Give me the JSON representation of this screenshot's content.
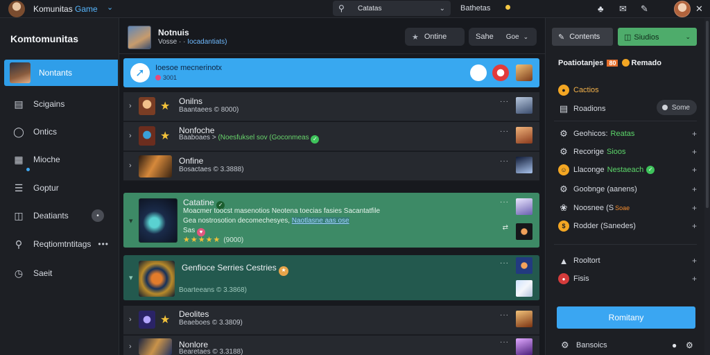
{
  "app": {
    "title_main": "Komunitas",
    "title_accent": "Game",
    "search_value": "Catatas",
    "top_tab": "Bathetas"
  },
  "sidebar": {
    "title": "Komtomunitas",
    "items": [
      {
        "label": "Nontants",
        "icon": "user-avatar"
      },
      {
        "label": "Scigains",
        "icon": "columns-icon"
      },
      {
        "label": "Ontics",
        "icon": "circle-icon"
      },
      {
        "label": "Mioche",
        "icon": "calendar-icon"
      },
      {
        "label": "Goptur",
        "icon": "list-icon"
      },
      {
        "label": "Deatiants",
        "icon": "book-icon"
      },
      {
        "label": "Reqtiomtntitags",
        "icon": "tag-icon"
      },
      {
        "label": "Saeit",
        "icon": "clock-icon"
      }
    ]
  },
  "header": {
    "title": "Notnuis",
    "subtitle": "Vosse · ·",
    "subtitle_accent": "Iocadantiats)",
    "btn_online": "Ontine",
    "btn_sahe": "Sahe",
    "btn_more": "Goe"
  },
  "banner": {
    "title": "Ioesoe mecnerinotx",
    "sub": "3001"
  },
  "rows": [
    {
      "title": "Onilns",
      "sub": "Baantaees",
      "sub_tail": "© 8000)",
      "dots": "···"
    },
    {
      "title": "Nonfoche",
      "sub": "Baaboaes",
      "sub_green": "(Noesfuksel sov (Goconmeas",
      "dots": "···"
    },
    {
      "title": "Onfine",
      "sub": "Bosactaes",
      "sub_tail": "© 3.3888)",
      "dots": "···"
    },
    {
      "title": "Catatine",
      "line1": "Moacmer toocst masenotios Neotena toecias fasies Sacantatfile",
      "line2_a": "Gea nostrosotion decomechesyes,",
      "line2_link": "Naotlasne aas ose",
      "line3": "Sas",
      "rating_count": "(9000)",
      "dots": "···"
    },
    {
      "title": "Genfioce Serries Cestries",
      "sub": "Boarteeans",
      "sub_tail": "© 3.3868)",
      "dots": "···"
    },
    {
      "title": "Deolites",
      "sub": "Beaeboes",
      "sub_tail": "© 3.3809)",
      "dots": "···"
    },
    {
      "title": "Nonlore",
      "sub": "Bearetaes",
      "sub_tail": "© 3.3188)",
      "dots": "···"
    }
  ],
  "rpanel": {
    "btn_contents": "Contents",
    "btn_studios": "Siudios",
    "heading_a": "Poatiotanjes",
    "heading_tag": "80",
    "heading_b": "Remado",
    "items": [
      {
        "label": "Cactios"
      },
      {
        "label": "Roadions",
        "pill": "Some"
      },
      {
        "label": "Geohicos:",
        "green": "Reatas"
      },
      {
        "label": "Recorige",
        "green": "Sioos"
      },
      {
        "label": "Llaconge",
        "green": "Nestaeach"
      },
      {
        "label": "Goobnge (aanens)"
      },
      {
        "label": "Noosnee (S",
        "orange": "Soae"
      },
      {
        "label": "Rodder (Sanedes)"
      },
      {
        "label": "Rooltort"
      },
      {
        "label": "Fisis"
      }
    ],
    "cta": "Romitany",
    "foot": "Bansoics"
  }
}
